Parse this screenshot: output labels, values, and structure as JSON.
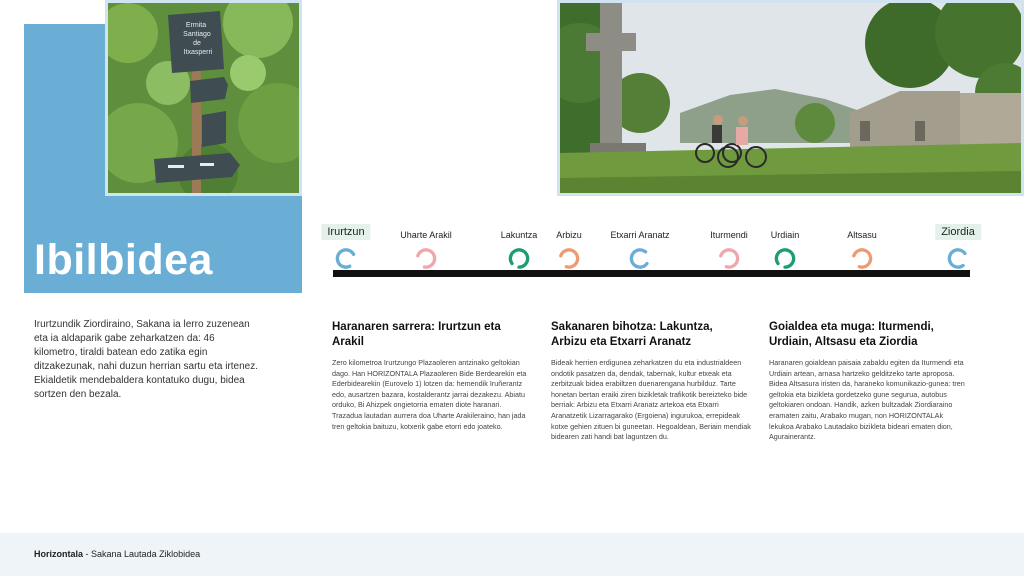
{
  "header": {
    "title": "Ibilbidea"
  },
  "photos": {
    "left": {
      "sign_text": [
        "Ermita",
        "Santiago",
        "de",
        "Itxasperri"
      ]
    },
    "right": {}
  },
  "route": {
    "stops": [
      {
        "name": "Irurtzun",
        "endpoint": true,
        "color": "#6aaed6"
      },
      {
        "name": "Uharte Arakil",
        "endpoint": false,
        "color": "#f0a6ad"
      },
      {
        "name": "Lakuntza",
        "endpoint": false,
        "color": "#1e9e6e"
      },
      {
        "name": "Arbizu",
        "endpoint": false,
        "color": "#ee9a73"
      },
      {
        "name": "Etxarri Aranatz",
        "endpoint": false,
        "color": "#6aaed6"
      },
      {
        "name": "Iturmendi",
        "endpoint": false,
        "color": "#f0a6ad"
      },
      {
        "name": "Urdiain",
        "endpoint": false,
        "color": "#1e9e6e"
      },
      {
        "name": "Altsasu",
        "endpoint": false,
        "color": "#ee9a73"
      },
      {
        "name": "Ziordia",
        "endpoint": true,
        "color": "#6aaed6"
      }
    ]
  },
  "intro": "Irurtzundik Ziordiraino, Sakana ia lerro zuzenean eta ia aldaparik gabe zeharkatzen da: 46 kilometro, tiraldi batean edo zatika egin ditzakezunak, nahi duzun herrian sartu eta irtenez. Ekialdetik mendebaldera kontatuko dugu, bidea sortzen den bezala.",
  "sections": [
    {
      "title": "Haranaren sarrera: Irurtzun eta Arakil",
      "body": "Zero kilometroa Irurtzungo Plazaoleren antzinako geltokian dago. Han HORIZONTALA Plazaoleren Bide Berdearekin eta Ederbidearekin (Eurovelo 1) lotzen da: hemendik Iruñerantz edo, ausartzen bazara, kostalderantz jarrai dezakezu. Abiatu orduko, Bi Ahizpek ongietorria ematen diote haranari. Trazadua lautadan aurrera doa Uharte Arakileraino, han jada tren geltokia baituzu, kotxerik gabe etorri edo joateko."
    },
    {
      "title": "Sakanaren bihotza: Lakuntza, Arbizu eta Etxarri Aranatz",
      "body": "Bideak herrien erdigunea zeharkatzen du eta industrialdeen ondotik pasatzen da, dendak, tabernak, kultur etxeak eta zerbitzuak bidea erabiltzen duenarengana hurbilduz. Tarte honetan bertan eraiki ziren bizikletak trafikotik bereizteko bide berriak: Arbizu eta Etxarri Aranatz artekoa eta Etxarri Aranatzetik Lizarragarako (Ergoiena) ingurukoa, errepideak kotxe gehien zituen bi guneetan. Hegoaldean, Beriain mendiak bidearen zati handi bat laguntzen du."
    },
    {
      "title": "Goialdea eta muga: Iturmendi, Urdiain, Altsasu eta Ziordia",
      "body": "Haranaren goialdean paisaia zabaldu egiten da Iturmendi eta Urdiain artean, arnasa hartzeko gelditzeko tarte aproposa. Bidea Altsasura iristen da, haraneko komunikazio-gunea: tren geltokia eta bizikleta gordetzeko gune segurua, autobus geltokiaren ondoan. Handik, azken bultzadak Ziordiaraino eramaten zaitu, Arabako mugan, non HORIZONTALAk lekukoa Arabako Lautadako bizikleta bideari ematen dion, Agurainerantz."
    }
  ],
  "footer": {
    "brand": "Horizontala",
    "separator": " - ",
    "subtitle": "Sakana Lautada Ziklobidea"
  }
}
